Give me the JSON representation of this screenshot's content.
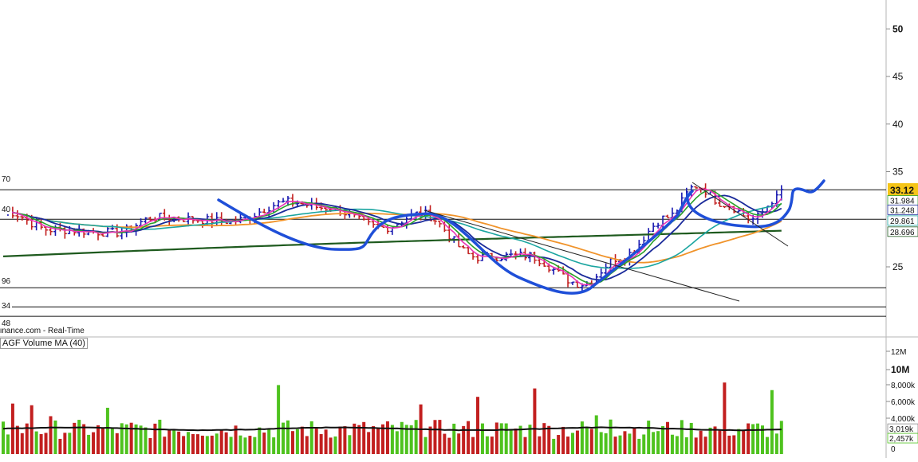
{
  "chart_data": [
    {
      "type": "candlestick",
      "panel": "price",
      "y_ticks": [
        50,
        45,
        40,
        35,
        25
      ],
      "ylim": [
        19.5,
        53
      ],
      "last_price": "33.12",
      "ma_tags": [
        {
          "label": "31.984",
          "color": "#2aa02a",
          "value": 31.984
        },
        {
          "label": "31.248",
          "color": "#1a2a9a",
          "value": 31.248
        },
        {
          "label": "29.861",
          "color": "#1aa5a0",
          "value": 29.861
        },
        {
          "label": "28.696",
          "color": "#1e5a1e",
          "value": 28.696
        }
      ],
      "left_tags": [
        "70",
        "40",
        "96",
        "34",
        "48"
      ],
      "source_text": "inance.com - Real-Time",
      "horizontal_lines": [
        33.1,
        30.0,
        22.8,
        20.8,
        19.8
      ]
    },
    {
      "type": "bar",
      "panel": "volume",
      "legend": "AGF Volume   MA (40)",
      "y_ticks": [
        "12M",
        "10M",
        "8,000k",
        "6,000k",
        "4,000k"
      ],
      "zero_label": "0",
      "ma_label": "3,019k",
      "last_label": "2,457k",
      "ylim_k": [
        0,
        12500
      ],
      "colors": {
        "up": "#4ec21e",
        "down": "#c21f1f",
        "ma": "#111111"
      }
    }
  ],
  "colors": {
    "ma5": "#e833b5",
    "ma10": "#2aa02a",
    "ma20": "#1a2a9a",
    "ma50": "#1aa5a0",
    "ma100": "#f0932a",
    "ma200": "#1e5a1e",
    "annotation": "#1f4fd8",
    "bar_up": "#1a1ab0",
    "bar_down": "#c21f1f"
  }
}
